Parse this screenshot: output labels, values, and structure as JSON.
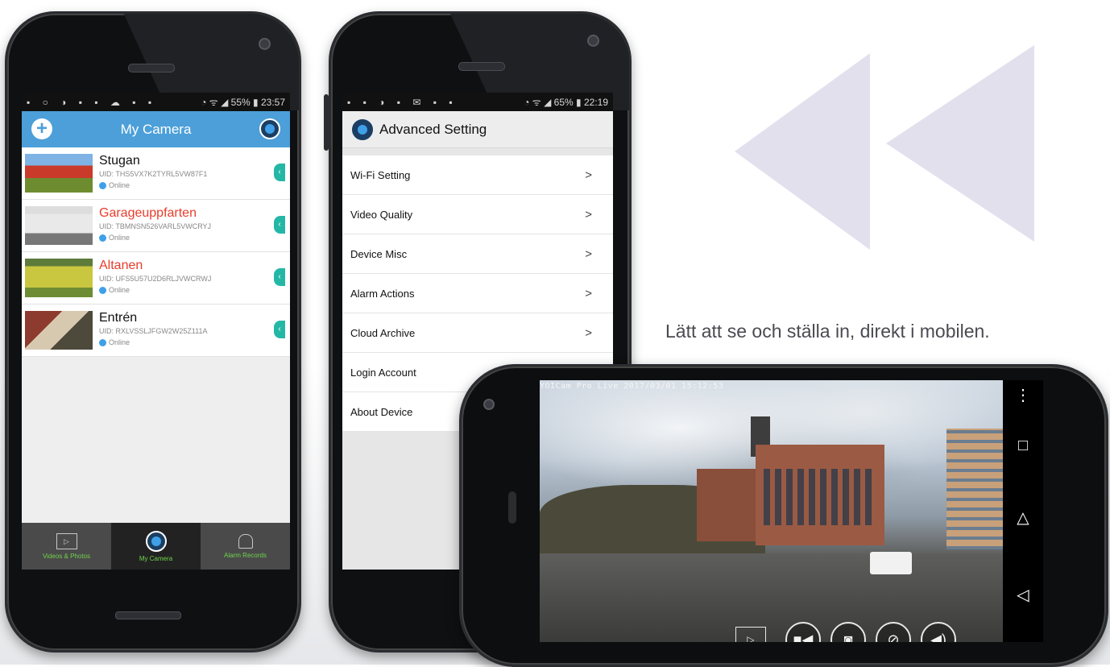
{
  "tagline": "Lätt att se och ställa in, direkt i mobilen.",
  "colors": {
    "accent": "#4c9fd8",
    "online": "#3fa0e8",
    "alert_name": "#e83c2a",
    "nav_green": "#6fd34a",
    "triangles": "#e3e0ee"
  },
  "phone1": {
    "status": {
      "battery": "55%",
      "time": "23:57"
    },
    "header_title": "My Camera",
    "cameras": [
      {
        "name": "Stugan",
        "uid": "UID: THS5VX7K2TYRL5VW87F1",
        "status": "Online",
        "highlight": false
      },
      {
        "name": "Garageuppfarten",
        "uid": "UID: TBMNSN526VARL5VWCRYJ",
        "status": "Online",
        "highlight": true
      },
      {
        "name": "Altanen",
        "uid": "UID: UFS5U57U2D6RLJVWCRWJ",
        "status": "Online",
        "highlight": true
      },
      {
        "name": "Entrén",
        "uid": "UID: RXLVSSLJFGW2W25Z111A",
        "status": "Online",
        "highlight": false
      }
    ],
    "nav": {
      "videos": "Videos & Photos",
      "camera": "My Camera",
      "alarms": "Alarm Records"
    }
  },
  "phone2": {
    "status": {
      "battery": "65%",
      "time": "22:19"
    },
    "header_title": "Advanced Setting",
    "items": [
      {
        "label": "Wi-Fi Setting",
        "chevron": ">"
      },
      {
        "label": "Video Quality",
        "chevron": ">"
      },
      {
        "label": "Device Misc",
        "chevron": ">"
      },
      {
        "label": "Alarm Actions",
        "chevron": ">"
      },
      {
        "label": "Cloud Archive",
        "chevron": ">"
      },
      {
        "label": "Login Account"
      },
      {
        "label": "About Device"
      }
    ]
  },
  "phone3": {
    "overlay": "YOICam Pro Live 2017/03/01 15:12:53",
    "controls": [
      "playback",
      "record",
      "snapshot",
      "mic-muted",
      "speaker-muted"
    ],
    "navbar": [
      "menu",
      "recents",
      "home",
      "back"
    ]
  }
}
